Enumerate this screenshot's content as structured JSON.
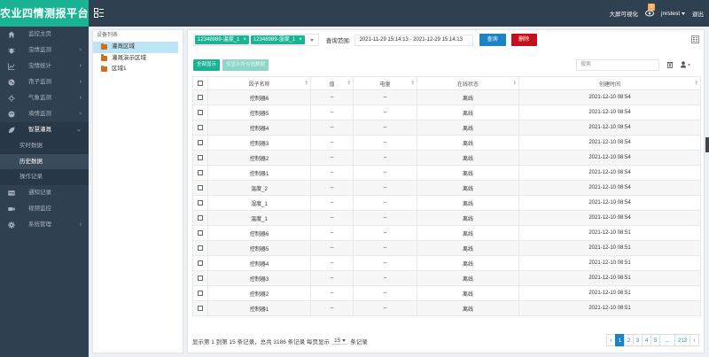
{
  "app": {
    "title": "农业四情测报平台"
  },
  "header": {
    "big_screen": "大屏可视化",
    "badge_count": "2",
    "username": "jnrstest",
    "logout": "退出"
  },
  "sidebar": {
    "items": [
      {
        "label": "监控主页",
        "icon": "home-icon",
        "has_children": false
      },
      {
        "label": "虫情监测",
        "icon": "bug-icon",
        "has_children": true
      },
      {
        "label": "虫情统计",
        "icon": "line-chart-icon",
        "has_children": true
      },
      {
        "label": "孢子监测",
        "icon": "spore-icon",
        "has_children": true
      },
      {
        "label": "气象监测",
        "icon": "weather-icon",
        "has_children": true
      },
      {
        "label": "墒情监测",
        "icon": "soil-icon",
        "has_children": true
      },
      {
        "label": "智慧灌溉",
        "icon": "leaf-icon",
        "has_children": true,
        "open": true
      }
    ],
    "sub_items": [
      {
        "label": "实时数据",
        "active": false
      },
      {
        "label": "历史数据",
        "active": true
      },
      {
        "label": "操作记录",
        "active": false
      }
    ],
    "bottom_items": [
      {
        "label": "通知记录",
        "icon": "card-icon",
        "has_children": false
      },
      {
        "label": "视频监控",
        "icon": "video-icon",
        "has_children": false
      },
      {
        "label": "系统管理",
        "icon": "gear-icon",
        "has_children": true
      }
    ]
  },
  "tree": {
    "title": "设备列表",
    "nodes": [
      {
        "label": "灌溉区域",
        "selected": true
      },
      {
        "label": "灌溉演示区域",
        "selected": false
      },
      {
        "label": "区域1",
        "selected": false
      }
    ]
  },
  "filter": {
    "tags": [
      "12348989-温度_1",
      "12348989-湿度_1"
    ],
    "range_label": "查询范围:",
    "range_value": "2021-11-29 15:14:13 - 2021-12-29 15:14:13",
    "query_button": "查询",
    "delete_button": "删除"
  },
  "toolbar": {
    "show_all": "全部显示",
    "view_selected": "仅显示所勾选数据",
    "search_placeholder": "搜索"
  },
  "table": {
    "columns": [
      "因子名称",
      "值",
      "电量",
      "在线状态",
      "创建时间"
    ],
    "rows": [
      {
        "name": "控制器6",
        "value": "--",
        "battery": "--",
        "status": "离线",
        "time": "2021-12-10 08:54"
      },
      {
        "name": "控制器5",
        "value": "--",
        "battery": "--",
        "status": "离线",
        "time": "2021-12-10 08:54"
      },
      {
        "name": "控制器4",
        "value": "--",
        "battery": "--",
        "status": "离线",
        "time": "2021-12-10 08:54"
      },
      {
        "name": "控制器3",
        "value": "--",
        "battery": "--",
        "status": "离线",
        "time": "2021-12-10 08:54"
      },
      {
        "name": "控制器2",
        "value": "--",
        "battery": "--",
        "status": "离线",
        "time": "2021-12-10 08:54"
      },
      {
        "name": "控制器1",
        "value": "--",
        "battery": "--",
        "status": "离线",
        "time": "2021-12-10 08:54"
      },
      {
        "name": "温度_2",
        "value": "--",
        "battery": "--",
        "status": "离线",
        "time": "2021-12-10 08:54"
      },
      {
        "name": "湿度_1",
        "value": "--",
        "battery": "--",
        "status": "离线",
        "time": "2021-12-10 08:54"
      },
      {
        "name": "温度_1",
        "value": "--",
        "battery": "--",
        "status": "离线",
        "time": "2021-12-10 08:54"
      },
      {
        "name": "控制器6",
        "value": "--",
        "battery": "--",
        "status": "离线",
        "time": "2021-12-10 08:51"
      },
      {
        "name": "控制器5",
        "value": "--",
        "battery": "--",
        "status": "离线",
        "time": "2021-12-10 08:51"
      },
      {
        "name": "控制器4",
        "value": "--",
        "battery": "--",
        "status": "离线",
        "time": "2021-12-10 08:51"
      },
      {
        "name": "控制器3",
        "value": "--",
        "battery": "--",
        "status": "离线",
        "time": "2021-12-10 08:51"
      },
      {
        "name": "控制器2",
        "value": "--",
        "battery": "--",
        "status": "离线",
        "time": "2021-12-10 08:51"
      },
      {
        "name": "控制器1",
        "value": "--",
        "battery": "--",
        "status": "离线",
        "time": "2021-12-10 08:51"
      }
    ]
  },
  "footer": {
    "summary": "显示第 1 到第 15 条记录，总共 3186 条记录  每页显示",
    "page_size": "15",
    "suffix": "条记录"
  },
  "pagination": {
    "pages": [
      "‹",
      "1",
      "2",
      "3",
      "4",
      "5",
      "...",
      "213",
      "›"
    ],
    "active": "1"
  },
  "colors": {
    "header_bg": "#2f4050",
    "brand": "#1ab394",
    "primary": "#1c84c6",
    "danger": "#c50f1c"
  }
}
